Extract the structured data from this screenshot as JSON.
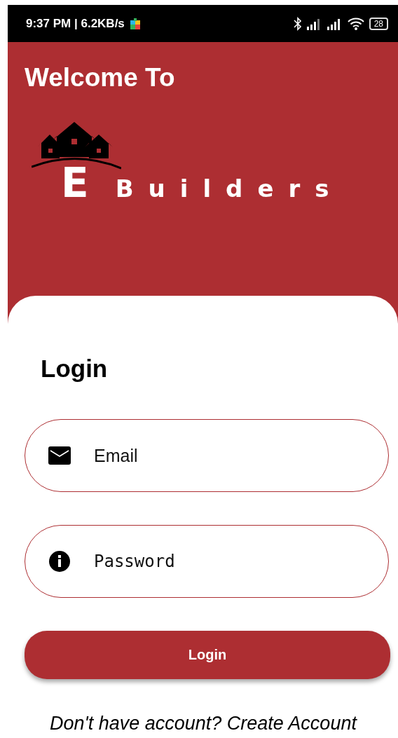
{
  "status_bar": {
    "time": "9:37 PM | 6.2KB/s",
    "battery": "28"
  },
  "header": {
    "title": "Welcome To",
    "logo_letter": "E",
    "logo_word": "Builders"
  },
  "login": {
    "title": "Login",
    "fields": [
      {
        "kind": "email",
        "placeholder": "Email"
      },
      {
        "kind": "password",
        "placeholder": "Password"
      }
    ],
    "button": "Login",
    "footer": "Don't have account? Create Account"
  }
}
